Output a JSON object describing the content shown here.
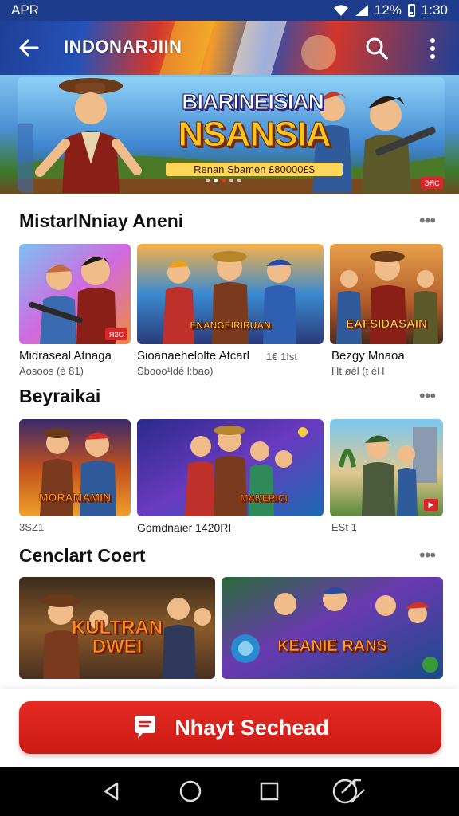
{
  "status_bar": {
    "carrier": "APR",
    "battery": "12%",
    "time": "1:30"
  },
  "app_bar": {
    "title": "INDONARJIIN"
  },
  "hero": {
    "line1": "BIARINEISIAN",
    "line2": "NSANSIA",
    "subtitle": "Renan Sbamen £80000£$",
    "badge": "ЭЯС"
  },
  "sections": [
    {
      "title": "MistarlNniay Aneni",
      "tiles": [
        {
          "title": "Midraseal Atnaga",
          "sub": "Aosoos (è 81)",
          "badge": "ЯЗС"
        },
        {
          "title": "Sioanaehelolte Atcarl",
          "title_extra": "1€ 1Ist",
          "sub": "Sbooo¹ldé l:bao)",
          "banner": "ENANGEIRIRUAN"
        },
        {
          "title": "Bezgy Mnaoa",
          "sub": "Ht øél (t ėH",
          "banner": "EAFSIDASAIN"
        }
      ]
    },
    {
      "title": "Beyraikai",
      "tiles": [
        {
          "sub": "3SZ1",
          "banner": "MORAMAMIN"
        },
        {
          "sub": "Gomdnaier 1420RI",
          "banner": "MAKERICI"
        },
        {
          "sub": "ESt 1"
        }
      ]
    },
    {
      "title": "Cenclart Coert",
      "tiles": [
        {
          "banner": "KULTRAN DWEI"
        },
        {
          "banner": "KEANIE RANS"
        }
      ]
    }
  ],
  "cta": {
    "label": "Nhayt Sechead"
  },
  "colors": {
    "status_bar": "#1d3d8c",
    "cta": "#d8201a",
    "nav_bar": "#000000"
  },
  "icons": [
    "wifi-icon",
    "signal-icon",
    "battery-icon",
    "back-arrow-icon",
    "search-icon",
    "more-vert-icon",
    "chat-icon",
    "nav-back-icon",
    "nav-home-icon",
    "nav-recents-icon",
    "assistant-icon"
  ]
}
